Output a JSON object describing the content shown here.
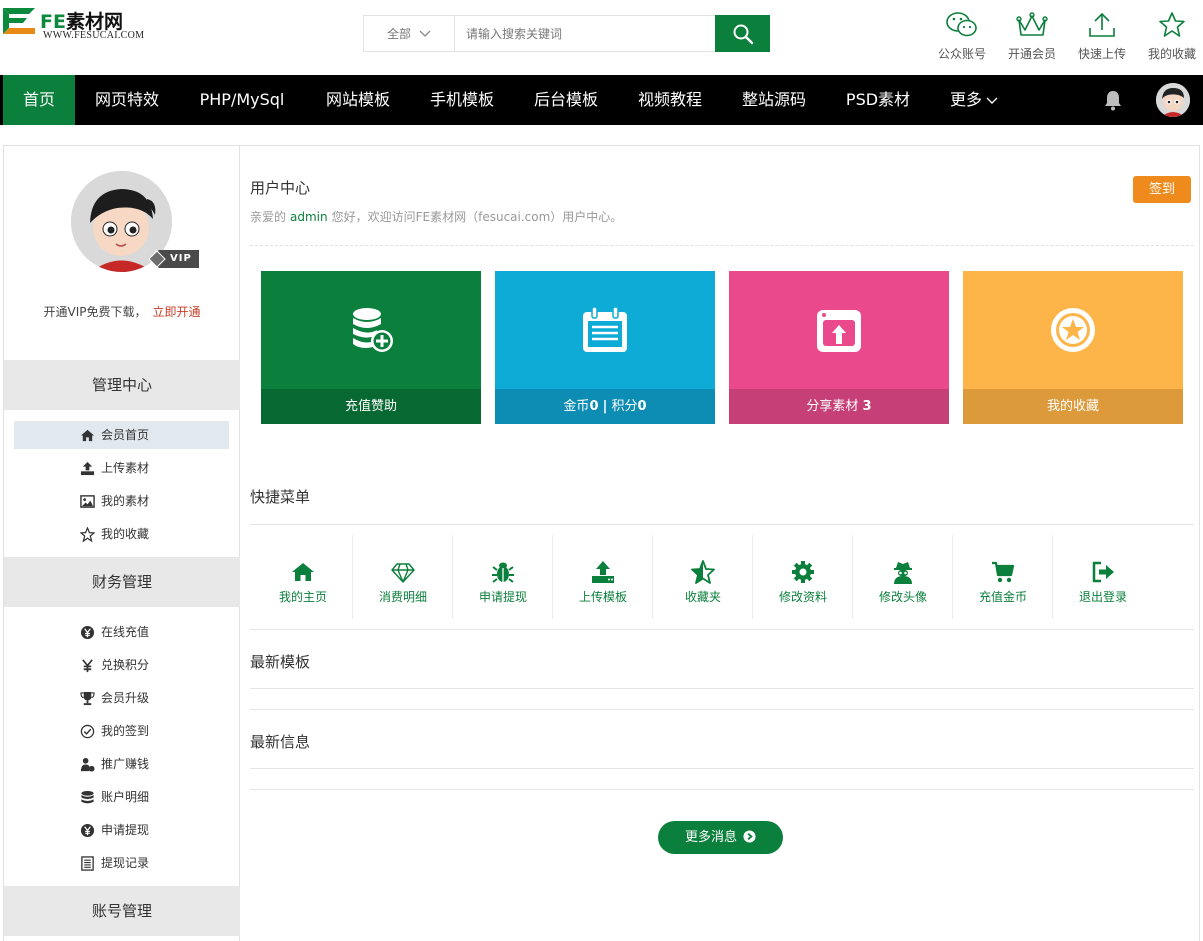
{
  "brand": {
    "logo_fe": "FE",
    "logo_name": "素材网",
    "logo_url_text": "WWW.FESUCAI.COM"
  },
  "search": {
    "category": "全部",
    "placeholder": "请输入搜索关键词"
  },
  "quick_links": [
    {
      "label": "公众账号",
      "icon": "wechat-icon"
    },
    {
      "label": "开通会员",
      "icon": "crown-icon"
    },
    {
      "label": "快速上传",
      "icon": "upload-icon"
    },
    {
      "label": "我的收藏",
      "icon": "star-icon"
    }
  ],
  "nav": {
    "items": [
      "首页",
      "网页特效",
      "PHP/MySql",
      "网站模板",
      "手机模板",
      "后台模板",
      "视频教程",
      "整站源码",
      "PSD素材"
    ],
    "more": "更多",
    "active_index": 0
  },
  "sidebar": {
    "vip_text": "开通VIP免费下载，",
    "vip_link": "立即开通",
    "vip_badge": "VIP",
    "groups": [
      {
        "title": "管理中心",
        "items": [
          {
            "label": "会员首页",
            "icon": "home-icon",
            "active": true
          },
          {
            "label": "上传素材",
            "icon": "upload-icon"
          },
          {
            "label": "我的素材",
            "icon": "image-icon"
          },
          {
            "label": "我的收藏",
            "icon": "star-icon"
          }
        ]
      },
      {
        "title": "财务管理",
        "items": [
          {
            "label": "在线充值",
            "icon": "yen-icon"
          },
          {
            "label": "兑换积分",
            "icon": "exchange-icon"
          },
          {
            "label": "会员升级",
            "icon": "trophy-icon"
          },
          {
            "label": "我的签到",
            "icon": "check-circle-icon"
          },
          {
            "label": "推广赚钱",
            "icon": "user-money-icon"
          },
          {
            "label": "账户明细",
            "icon": "database-icon"
          },
          {
            "label": "申请提现",
            "icon": "yen-icon"
          },
          {
            "label": "提现记录",
            "icon": "list-icon"
          }
        ]
      },
      {
        "title": "账号管理",
        "items": []
      }
    ]
  },
  "user_center": {
    "title": "用户中心",
    "welcome_prefix": "亲爱的",
    "username": "admin",
    "welcome_suffix": "您好，欢迎访问FE素材网（fesucai.com）用户中心。",
    "signin_label": "签到"
  },
  "tiles": [
    {
      "label": "充值赞助",
      "icon": "coins-add-icon",
      "color": "#0b7f3c",
      "bar_color": "#086832"
    },
    {
      "label_prefix": "金币",
      "gold": "0",
      "separator": "|",
      "points_label": "积分",
      "points": "0",
      "icon": "notepad-icon",
      "color": "#0eabd6",
      "bar_color": "#0d8db3"
    },
    {
      "label_prefix": "分享素材",
      "count": "3",
      "icon": "share-upload-icon",
      "color": "#ea4a8b",
      "bar_color": "#c63f76"
    },
    {
      "label": "我的收藏",
      "icon": "star-circle-icon",
      "color": "#fdb54a",
      "bar_color": "#dc9a3a"
    }
  ],
  "shortcuts": {
    "title": "快捷菜单",
    "items": [
      {
        "label": "我的主页",
        "icon": "home-icon"
      },
      {
        "label": "消费明细",
        "icon": "diamond-icon"
      },
      {
        "label": "申请提现",
        "icon": "bug-icon"
      },
      {
        "label": "上传模板",
        "icon": "upload-icon"
      },
      {
        "label": "收藏夹",
        "icon": "star-half-icon"
      },
      {
        "label": "修改资料",
        "icon": "gear-icon"
      },
      {
        "label": "修改头像",
        "icon": "user-secret-icon"
      },
      {
        "label": "充值金币",
        "icon": "cart-icon"
      },
      {
        "label": "退出登录",
        "icon": "sign-out-icon"
      }
    ]
  },
  "sections": {
    "latest_templates": "最新模板",
    "latest_info": "最新信息",
    "more_label": "更多消息"
  },
  "colors": {
    "brand_green": "#0b7f3c",
    "accent_orange": "#ef8b1c",
    "vip_red": "#c43d28"
  }
}
